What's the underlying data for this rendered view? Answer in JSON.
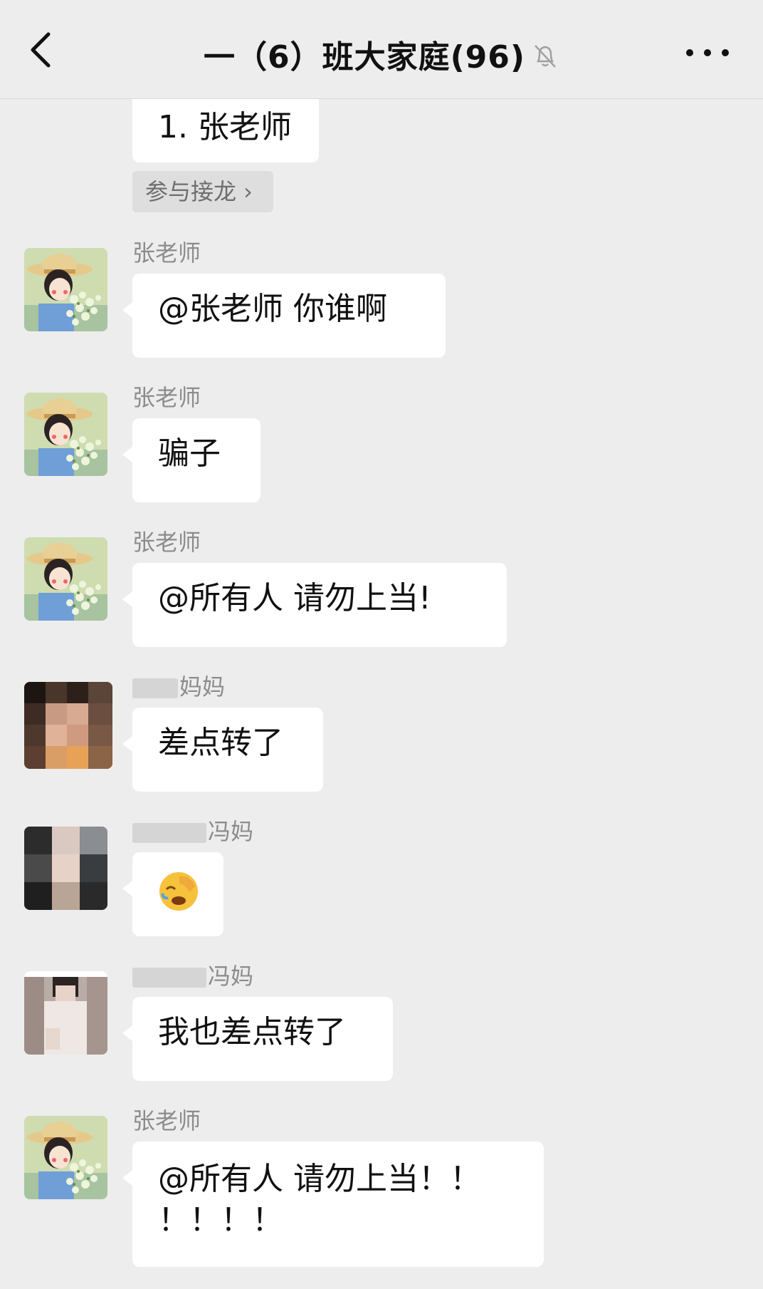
{
  "header": {
    "title": "一（6）班大家庭(96)",
    "back_icon": "chevron-left-icon",
    "mute_icon": "bell-off-icon",
    "more_icon": "ellipsis-icon"
  },
  "solitaire": {
    "item": "1. 张老师",
    "join_label": "参与接龙 ›"
  },
  "messages": [
    {
      "sender": "张老师",
      "text": "@张老师  你谁啊"
    },
    {
      "sender": "张老师",
      "text": "骗子"
    },
    {
      "sender": "张老师",
      "text": "@所有人  请勿上当!"
    },
    {
      "sender": "妈妈",
      "text": "差点转了"
    },
    {
      "sender": "冯妈",
      "text": "🤦"
    },
    {
      "sender": "冯妈",
      "text": "我也差点转了"
    },
    {
      "sender": "张老师",
      "line1": "@所有人  请勿上当！！",
      "line2": "！！！！"
    }
  ],
  "colors": {
    "background": "#ededed",
    "bubble": "#ffffff",
    "sender_text": "#8c8c8c"
  }
}
